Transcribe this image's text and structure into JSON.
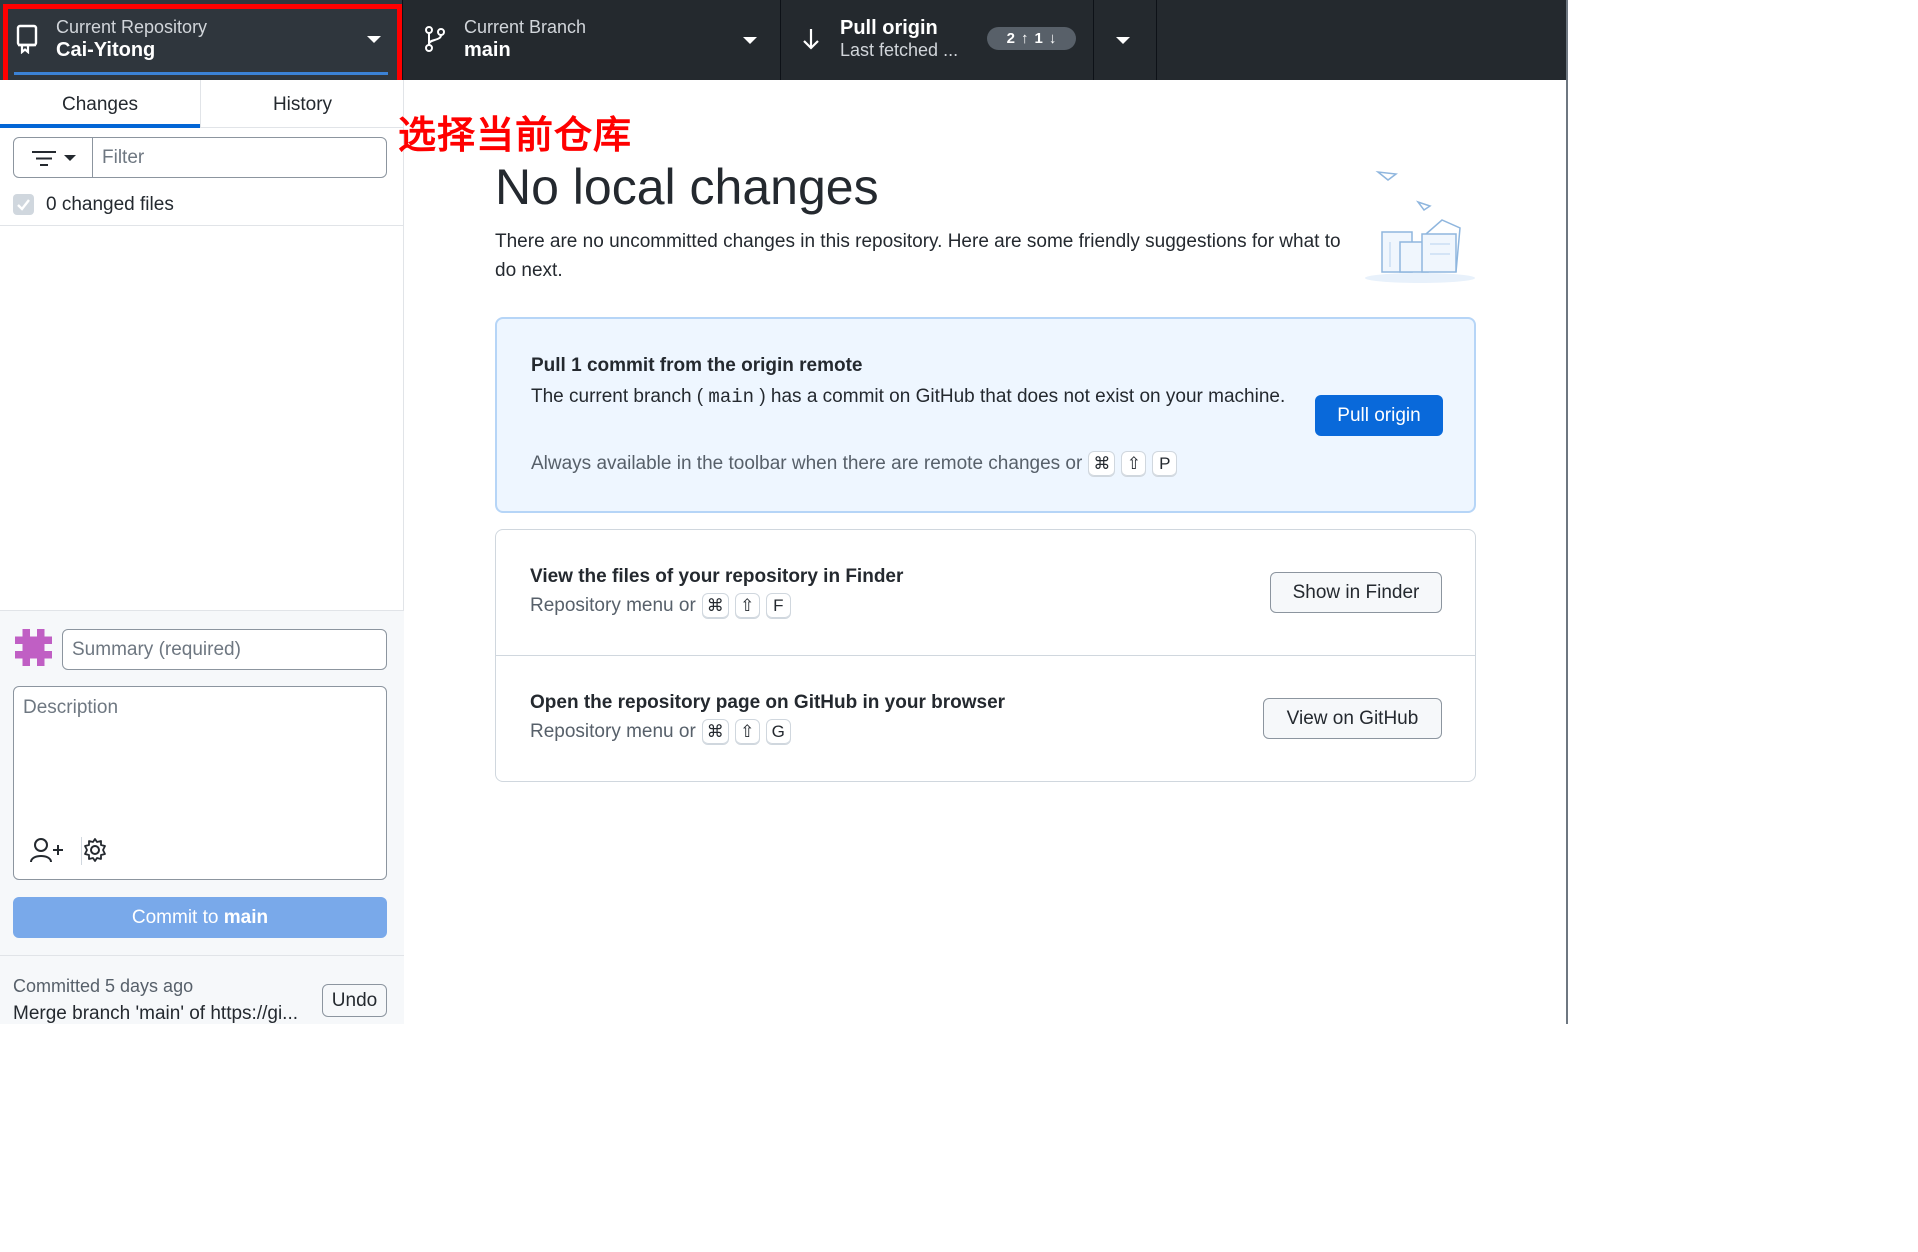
{
  "toolbar": {
    "repository": {
      "label": "Current Repository",
      "value": "Cai-Yitong"
    },
    "branch": {
      "label": "Current Branch",
      "value": "main"
    },
    "pull": {
      "label": "Pull origin",
      "sublabel": "Last fetched ...",
      "ahead": "2",
      "behind": "1"
    }
  },
  "annotation": {
    "text": "选择当前仓库",
    "color": "#ff0000"
  },
  "sidebar": {
    "tabs": [
      {
        "label": "Changes",
        "active": true
      },
      {
        "label": "History",
        "active": false
      }
    ],
    "filter": {
      "placeholder": "Filter"
    },
    "changed_files": "0 changed files",
    "summary": {
      "placeholder": "Summary (required)"
    },
    "description": {
      "placeholder": "Description"
    },
    "commit_button": {
      "prefix": "Commit to ",
      "branch": "main"
    },
    "last_commit": {
      "meta": "Committed 5 days ago",
      "message": "Merge branch 'main' of https://gi...",
      "undo_label": "Undo"
    }
  },
  "main": {
    "title": "No local changes",
    "subtitle": "There are no uncommitted changes in this repository. Here are some friendly suggestions for what to do next.",
    "pull_card": {
      "heading": "Pull 1 commit from the origin remote",
      "text_before": "The current branch (",
      "branch": "main",
      "text_after": ") has a commit on GitHub that does not exist on your machine.",
      "hint": "Always available in the toolbar when there are remote changes or",
      "keys": [
        "⌘",
        "⇧",
        "P"
      ],
      "button": "Pull origin"
    },
    "finder_card": {
      "heading": "View the files of your repository in Finder",
      "hint": "Repository menu or",
      "keys": [
        "⌘",
        "⇧",
        "F"
      ],
      "button": "Show in Finder"
    },
    "github_card": {
      "heading": "Open the repository page on GitHub in your browser",
      "hint": "Repository menu or",
      "keys": [
        "⌘",
        "⇧",
        "G"
      ],
      "button": "View on GitHub"
    }
  },
  "colors": {
    "toolbar_bg": "#24292e",
    "accent": "#0969da",
    "commit_button_disabled": "#79a9ea",
    "annotation_red": "#ff0000",
    "avatar": "#c05fc4"
  }
}
